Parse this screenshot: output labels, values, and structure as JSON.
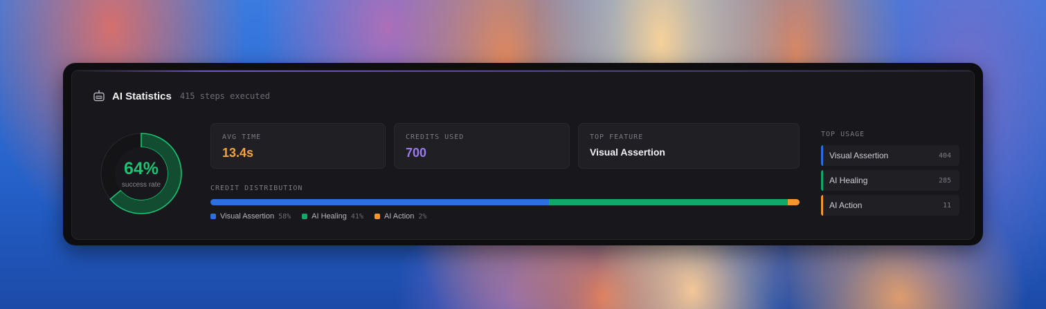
{
  "header": {
    "title": "AI Statistics",
    "subtitle": "415 steps executed",
    "icon": "robot-icon"
  },
  "success": {
    "percent_label": "64%",
    "label": "success rate",
    "value": 0.64,
    "color": "#19c472"
  },
  "stats": [
    {
      "label": "AVG TIME",
      "value": "13.4s",
      "color": "#f6a43a"
    },
    {
      "label": "CREDITS USED",
      "value": "700",
      "color": "#9b7cf0"
    },
    {
      "label": "TOP FEATURE",
      "value": "Visual Assertion",
      "color": "#f2f2f4"
    }
  ],
  "distribution": {
    "label": "CREDIT DISTRIBUTION",
    "items": [
      {
        "name": "Visual Assertion",
        "pct": "58%",
        "value": 0.58,
        "color": "#2d6fe0"
      },
      {
        "name": "AI Healing",
        "pct": "41%",
        "value": 0.41,
        "color": "#12a86a"
      },
      {
        "name": "AI Action",
        "pct": "2%",
        "value": 0.02,
        "color": "#f59630"
      }
    ]
  },
  "top_usage": {
    "title": "TOP USAGE",
    "items": [
      {
        "name": "Visual Assertion",
        "count": "404",
        "color": "#2d6fe0"
      },
      {
        "name": "AI Healing",
        "count": "285",
        "color": "#12a86a"
      },
      {
        "name": "AI Action",
        "count": "11",
        "color": "#f59630"
      }
    ]
  }
}
